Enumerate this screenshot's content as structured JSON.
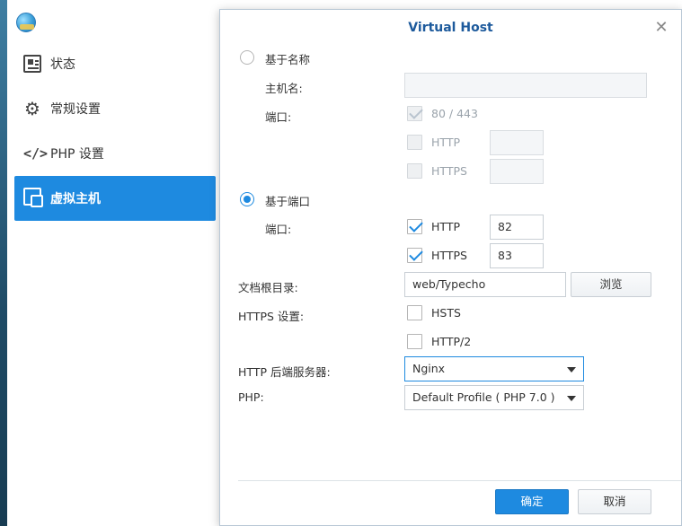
{
  "sidebar": {
    "items": [
      {
        "label": "状态",
        "icon": "status-icon"
      },
      {
        "label": "常规设置",
        "icon": "gear-icon"
      },
      {
        "label": "PHP 设置",
        "icon": "code-icon"
      },
      {
        "label": "虚拟主机",
        "icon": "virtual-host-icon",
        "active": true
      }
    ]
  },
  "dialog": {
    "title": "Virtual Host",
    "name_based": {
      "radio_label": "基于名称",
      "hostname_label": "主机名:",
      "hostname_value": "",
      "port_label": "端口:",
      "default_port_label": "80 / 443",
      "http_label": "HTTP",
      "http_port": "",
      "https_label": "HTTPS",
      "https_port": ""
    },
    "port_based": {
      "radio_label": "基于端口",
      "port_label": "端口:",
      "http_label": "HTTP",
      "http_port": "82",
      "https_label": "HTTPS",
      "https_port": "83"
    },
    "docroot": {
      "label": "文档根目录:",
      "value": "web/Typecho",
      "browse_label": "浏览"
    },
    "https_settings": {
      "label": "HTTPS 设置:",
      "hsts_label": "HSTS",
      "http2_label": "HTTP/2"
    },
    "backend": {
      "label": "HTTP 后端服务器:",
      "value": "Nginx"
    },
    "php": {
      "label": "PHP:",
      "value": "Default Profile ( PHP 7.0 )"
    },
    "ok_label": "确定",
    "cancel_label": "取消"
  },
  "colors": {
    "accent": "#1e8ae0",
    "title": "#1d5a9c"
  }
}
